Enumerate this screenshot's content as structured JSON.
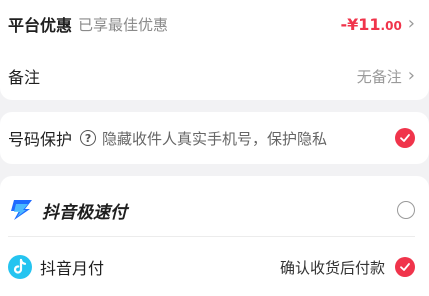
{
  "discount": {
    "label": "平台优惠",
    "sub": "已享最佳优惠",
    "amount_int": "-¥11",
    "amount_dec": ".00",
    "chevron": "›"
  },
  "remark": {
    "label": "备注",
    "value": "无备注",
    "chevron": "›"
  },
  "privacy": {
    "label": "号码保护",
    "help": "?",
    "desc": "隐藏收件人真实手机号，保护隐私"
  },
  "payment": {
    "options": [
      {
        "label": "抖音极速付"
      },
      {
        "label": "抖音月付",
        "hint": "确认收货后付款"
      }
    ]
  },
  "colors": {
    "accent": "#f0344b",
    "brand_blue": "#1f6bff",
    "tiktok_cyan": "#25c4f0"
  }
}
